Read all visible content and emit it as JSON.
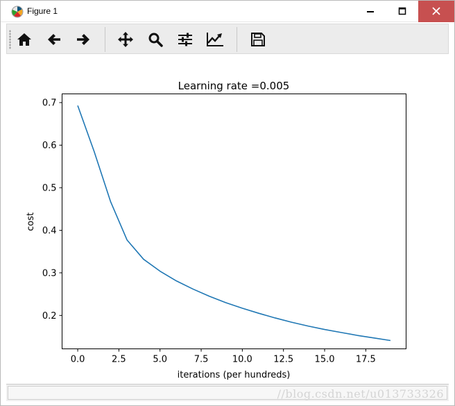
{
  "window": {
    "title": "Figure 1"
  },
  "toolbar": {
    "tools": [
      {
        "icon": "home-icon"
      },
      {
        "icon": "back-arrow-icon"
      },
      {
        "icon": "forward-arrow-icon"
      },
      {
        "icon": "pan-move-icon"
      },
      {
        "icon": "zoom-magnifier-icon"
      },
      {
        "icon": "configure-subplots-icon"
      },
      {
        "icon": "edit-axis-icon"
      },
      {
        "icon": "save-floppy-icon"
      }
    ]
  },
  "status": {
    "watermark": "//blog.csdn.net/u013733326"
  },
  "colors": {
    "line": "#1f77b4",
    "close_button": "#c75050"
  },
  "chart_data": {
    "type": "line",
    "title": "Learning rate =0.005",
    "xlabel": "iterations (per hundreds)",
    "ylabel": "cost",
    "xlim": [
      -0.95,
      19.95
    ],
    "ylim": [
      0.1215,
      0.7205
    ],
    "xticks": [
      0.0,
      2.5,
      5.0,
      7.5,
      10.0,
      12.5,
      15.0,
      17.5
    ],
    "xtick_labels": [
      "0.0",
      "2.5",
      "5.0",
      "7.5",
      "10.0",
      "12.5",
      "15.0",
      "17.5"
    ],
    "yticks": [
      0.2,
      0.3,
      0.4,
      0.5,
      0.6,
      0.7
    ],
    "ytick_labels": [
      "0.2",
      "0.3",
      "0.4",
      "0.5",
      "0.6",
      "0.7"
    ],
    "grid": false,
    "series": [
      {
        "x": [
          0,
          1,
          2,
          3,
          4,
          5,
          6,
          7,
          8,
          9,
          10,
          11,
          12,
          13,
          14,
          15,
          16,
          17,
          18,
          19
        ],
        "values": [
          0.693,
          0.585,
          0.467,
          0.377,
          0.332,
          0.304,
          0.281,
          0.262,
          0.245,
          0.23,
          0.217,
          0.205,
          0.194,
          0.184,
          0.175,
          0.167,
          0.16,
          0.153,
          0.147,
          0.141
        ]
      }
    ]
  }
}
